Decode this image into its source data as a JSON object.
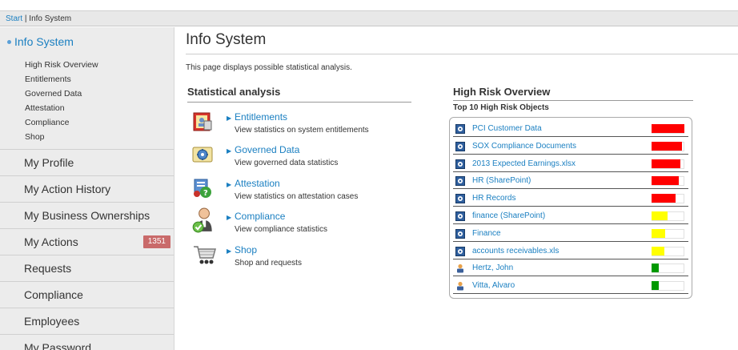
{
  "breadcrumb": {
    "start": "Start",
    "separator": "|",
    "current": "Info System"
  },
  "sidebar": {
    "active": {
      "title": "Info System",
      "subitems": [
        "High Risk Overview",
        "Entitlements",
        "Governed Data",
        "Attestation",
        "Compliance",
        "Shop"
      ]
    },
    "items": [
      {
        "label": "My Profile"
      },
      {
        "label": "My Action History"
      },
      {
        "label": "My Business Ownerships"
      },
      {
        "label": "My Actions",
        "badge": "1351"
      },
      {
        "label": "Requests"
      },
      {
        "label": "Compliance"
      },
      {
        "label": "Employees"
      },
      {
        "label": "My Password"
      }
    ]
  },
  "main": {
    "title": "Info System",
    "intro": "This page displays possible statistical analysis."
  },
  "stats": {
    "header": "Statistical analysis",
    "entries": [
      {
        "icon": "entitlements-icon",
        "link": "Entitlements",
        "desc": "View statistics on system entitlements"
      },
      {
        "icon": "governed-data-icon",
        "link": "Governed Data",
        "desc": "View governed data statistics"
      },
      {
        "icon": "attestation-icon",
        "link": "Attestation",
        "desc": "View statistics on attestation cases"
      },
      {
        "icon": "compliance-icon",
        "link": "Compliance",
        "desc": "View compliance statistics"
      },
      {
        "icon": "shop-cart-icon",
        "link": "Shop",
        "desc": "Shop and requests"
      }
    ]
  },
  "high_risk": {
    "header": "High Risk Overview",
    "subtitle": "Top 10 High Risk Objects",
    "colors": {
      "high": "#ff0000",
      "medium": "#ffff00",
      "low": "#009900"
    },
    "rows": [
      {
        "name": "PCI Customer Data",
        "icon": "data-object-icon",
        "level": "high",
        "risk": 1.0
      },
      {
        "name": "SOX Compliance Documents",
        "icon": "data-object-icon",
        "level": "high",
        "risk": 0.92
      },
      {
        "name": "2013 Expected Earnings.xlsx",
        "icon": "data-object-icon",
        "level": "high",
        "risk": 0.88
      },
      {
        "name": "HR (SharePoint)",
        "icon": "data-object-icon",
        "level": "high",
        "risk": 0.84
      },
      {
        "name": "HR Records",
        "icon": "data-object-icon",
        "level": "high",
        "risk": 0.74
      },
      {
        "name": "finance (SharePoint)",
        "icon": "data-object-icon",
        "level": "medium",
        "risk": 0.48
      },
      {
        "name": "Finance",
        "icon": "data-object-icon",
        "level": "medium",
        "risk": 0.42
      },
      {
        "name": "accounts receivables.xls",
        "icon": "data-object-icon",
        "level": "medium",
        "risk": 0.4
      },
      {
        "name": "Hertz, John",
        "icon": "person-icon",
        "level": "low",
        "risk": 0.22
      },
      {
        "name": "Vitta, Alvaro",
        "icon": "person-icon",
        "level": "low",
        "risk": 0.22
      }
    ]
  }
}
